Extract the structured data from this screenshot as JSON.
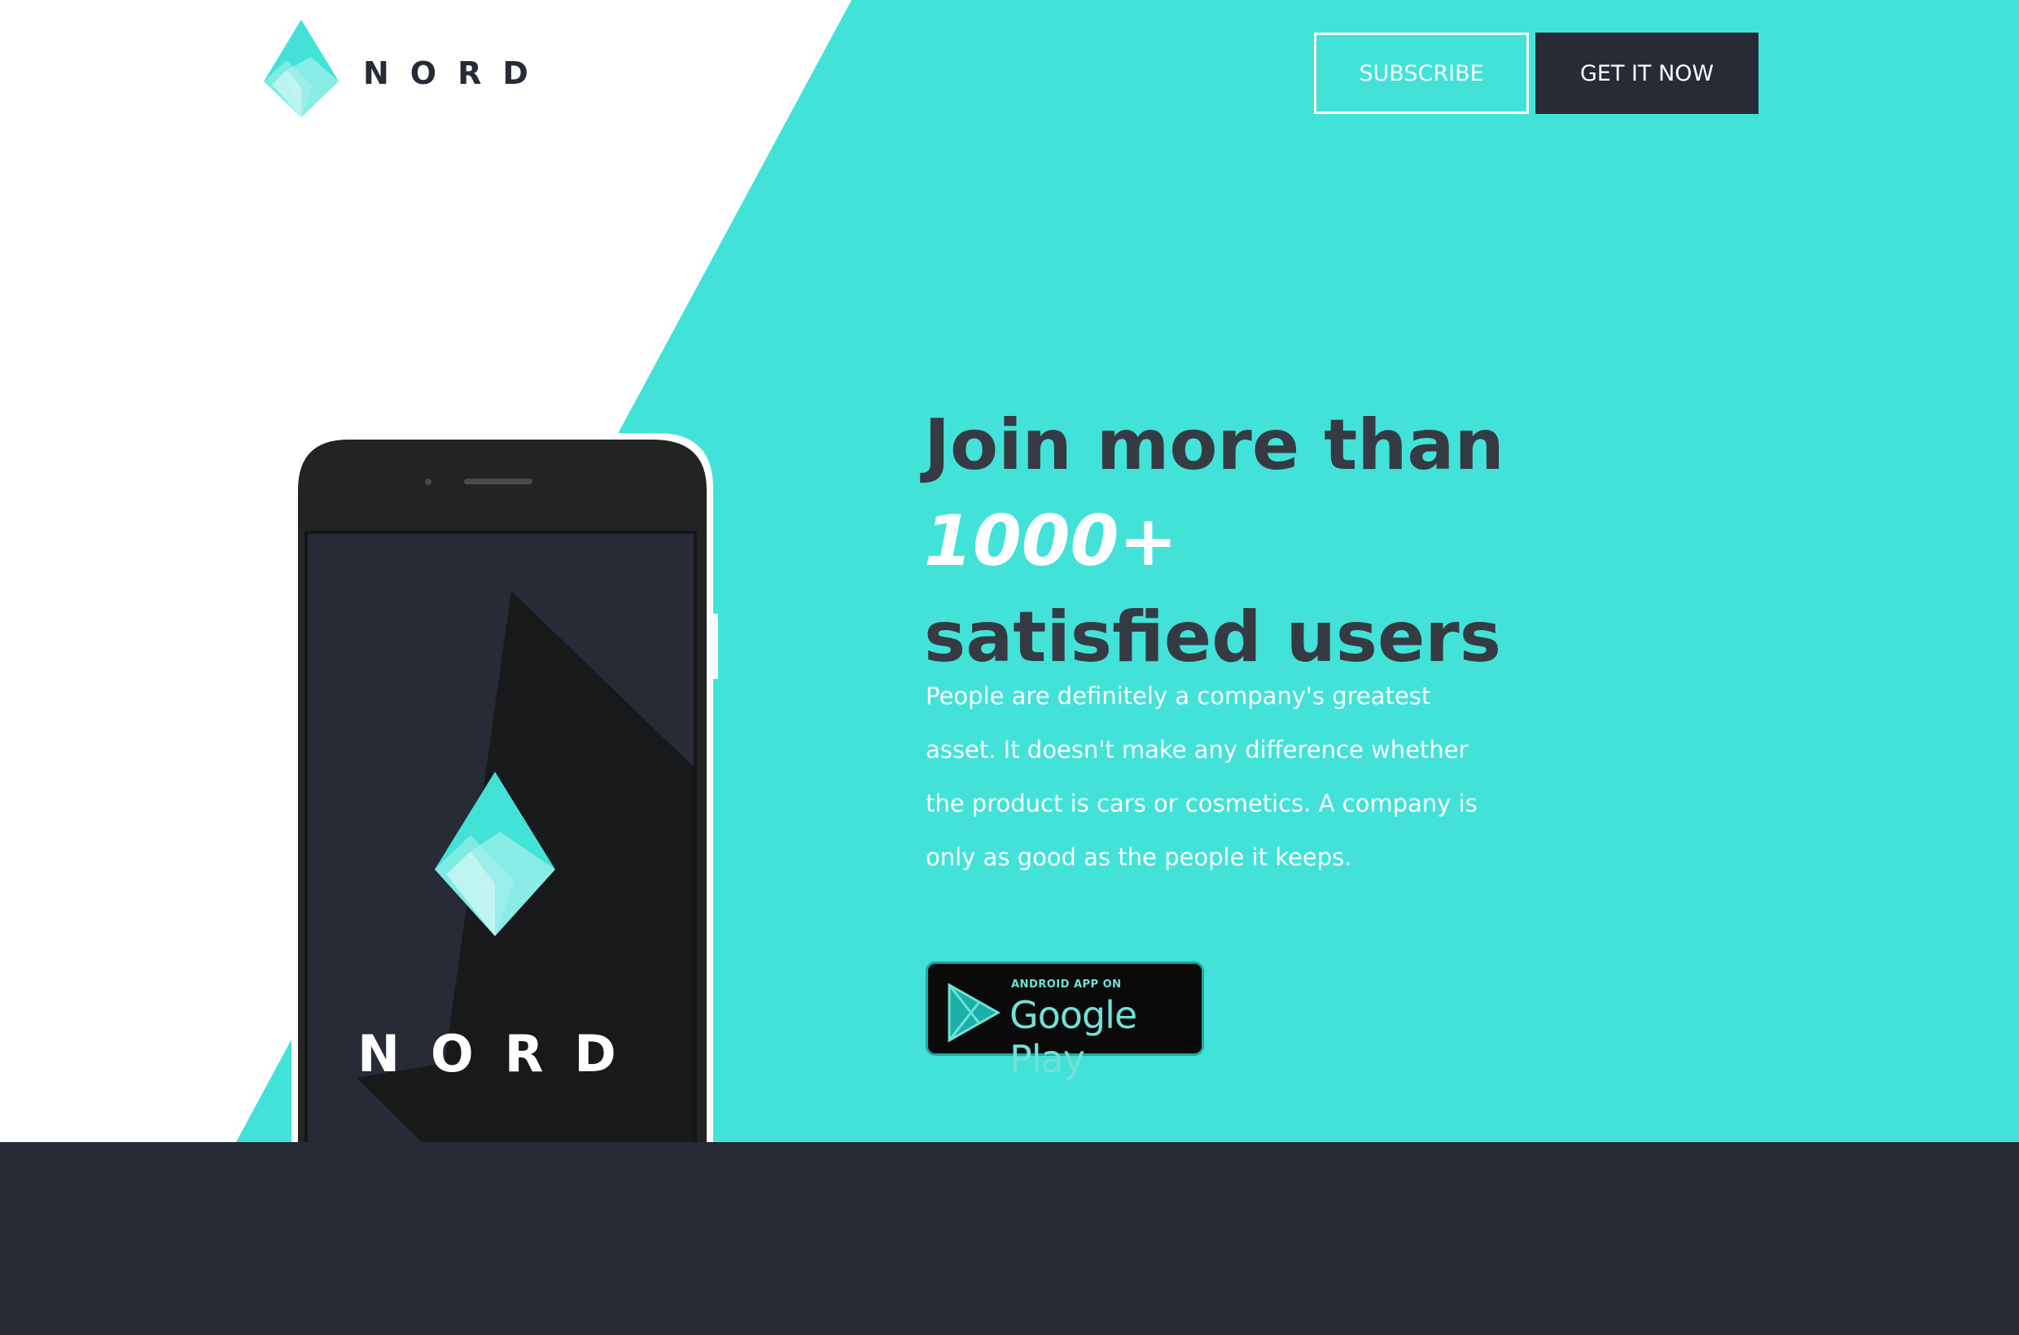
{
  "header": {
    "logo_text": "NORD",
    "subscribe_label": "SUBSCRIBE",
    "get_it_now_label": "GET IT NOW"
  },
  "hero": {
    "headline_prefix": "Join more than ",
    "headline_count": "1000+",
    "headline_suffix": "satisfied users",
    "description": "People are definitely a company's greatest asset. It doesn't make any difference whether the product is cars or cosmetics. A company is only as good as the people it keeps."
  },
  "google_play": {
    "small_text": "ANDROID APP ON",
    "big_text": "Google Play"
  },
  "phone": {
    "brand_text": "NORD"
  },
  "colors": {
    "accent": "#42e2d9",
    "dark": "#262b36",
    "heading": "#363a42",
    "white": "#ffffff"
  },
  "icons": [
    "nord-diamond-logo-icon",
    "google-play-icon",
    "smartphone-icon"
  ]
}
